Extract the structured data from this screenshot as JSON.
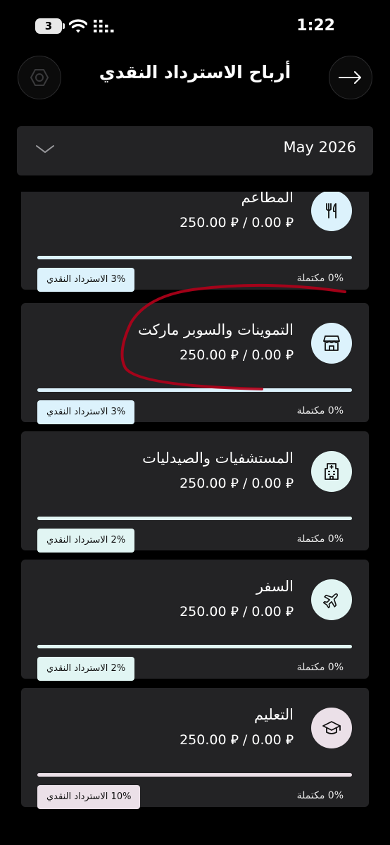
{
  "status_bar": {
    "battery": "3",
    "time": "1:22"
  },
  "header": {
    "title": "أرباح الاسترداد النقدي"
  },
  "month_selector": {
    "value": "May 2026"
  },
  "categories": [
    {
      "name": "المطاعم",
      "amount": "250.00 ⃁ / 0.00 ⃁",
      "progress": 0,
      "completed": "0% مكتملة",
      "cashback": "3% الاسترداد النقدي",
      "icon": "fork-knife-icon",
      "tint": "#dcf2fc"
    },
    {
      "name": "التموينات والسوبر ماركت",
      "amount": "250.00 ⃁ / 0.00 ⃁",
      "progress": 0,
      "completed": "0% مكتملة",
      "cashback": "3% الاسترداد النقدي",
      "icon": "store-icon",
      "tint": "#dcf2fc"
    },
    {
      "name": "المستشفيات والصيدليات",
      "amount": "250.00 ⃁ / 0.00 ⃁",
      "progress": 0,
      "completed": "0% مكتملة",
      "cashback": "2% الاسترداد النقدي",
      "icon": "hospital-icon",
      "tint": "#e1f5f3"
    },
    {
      "name": "السفر",
      "amount": "250.00 ⃁ / 0.00 ⃁",
      "progress": 0,
      "completed": "0% مكتملة",
      "cashback": "2% الاسترداد النقدي",
      "icon": "airplane-icon",
      "tint": "#e1f5f3"
    },
    {
      "name": "التعليم",
      "amount": "250.00 ⃁ / 0.00 ⃁",
      "progress": 0,
      "completed": "0% مكتملة",
      "cashback": "10% الاسترداد النقدي",
      "icon": "graduation-cap-icon",
      "tint": "#ebe0e8"
    }
  ],
  "annotation_color": "#b3001a"
}
